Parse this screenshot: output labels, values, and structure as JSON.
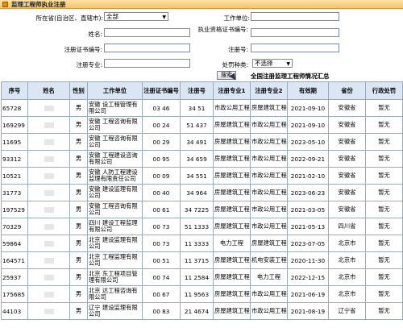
{
  "title": "监理工程师执业注册",
  "form": {
    "province_label": "所在省(自治区、直辖市):",
    "province_value": "全部",
    "unit_label": "工作单位:",
    "name_label": "姓名:",
    "license_label": "执业资格证书编号:",
    "reg_cert_label": "注册证书编号:",
    "reg_no_label": "注册号:",
    "major_label": "注册专业:",
    "penalty_label": "处罚种类:",
    "penalty_value": "不选择",
    "search_button": "搜索",
    "summary_link": "全国注册监理工程师情况汇总"
  },
  "table": {
    "headers": [
      "序号",
      "姓名",
      "性别",
      "工作单位",
      "注册证书编号",
      "注册号",
      "注册专业1",
      "注册专业2",
      "有效期",
      "省份",
      "行政处罚"
    ],
    "rows": [
      {
        "id": "65728",
        "gender": "男",
        "unit": "安徽 设工程管理有限公司",
        "cert": "03 46",
        "reg": "34 51",
        "major1": "市政公用工程",
        "major2": "房屋建筑工程",
        "valid": "2021-09-10",
        "prov": "安徽省",
        "penalty": "暂无"
      },
      {
        "id": "169299",
        "gender": "男",
        "unit": "安徽 工程咨询有限公司",
        "cert": "00 24",
        "reg": "51 437",
        "major1": "房屋建筑工程",
        "major2": "市政公用工程",
        "valid": "2021-09-10",
        "prov": "安徽省",
        "penalty": "暂无"
      },
      {
        "id": "11695",
        "gender": "男",
        "unit": "安徽 工程咨询有限公司",
        "cert": "00 29",
        "reg": "34 491",
        "major1": "房屋建筑工程",
        "major2": "市政公用工程",
        "valid": "2023-05-10",
        "prov": "安徽省",
        "penalty": "暂无"
      },
      {
        "id": "93312",
        "gender": "男",
        "unit": "安徽 工程建设咨询有限公司",
        "cert": "00 95",
        "reg": "34 659",
        "major1": "房屋建筑工程",
        "major2": "市政公用工程",
        "valid": "2022-09-21",
        "prov": "安徽省",
        "penalty": "暂无"
      },
      {
        "id": "10521",
        "gender": "男",
        "unit": "安徽 人防工程建设监理有限责任公司",
        "cert": "00 09",
        "reg": "34 551",
        "major1": "房屋建筑工程",
        "major2": "市政公用工程",
        "valid": "2021-02-10",
        "prov": "安徽省",
        "penalty": "暂无"
      },
      {
        "id": "31773",
        "gender": "男",
        "unit": "安徽 建设监理有限公司",
        "cert": "00 40",
        "reg": "34 964",
        "major1": "房屋建筑工程",
        "major2": "市政公用工程",
        "valid": "2023-06-23",
        "prov": "安徽省",
        "penalty": "暂无"
      },
      {
        "id": "197529",
        "gender": "男",
        "unit": "安徽 工程咨询有限公司",
        "cert": "00 61",
        "reg": "34 7225",
        "major1": "房屋建筑工程",
        "major2": "市政公用工程",
        "valid": "2021-03-05",
        "prov": "安徽省",
        "penalty": "暂无"
      },
      {
        "id": "70329",
        "gender": "男",
        "unit": "四川 建设工程监理有限公司",
        "cert": "00 73",
        "reg": "51 1333",
        "major1": "房屋建筑工程",
        "major2": "市政公用工程",
        "valid": "2021-05-13",
        "prov": "四川省",
        "penalty": "暂无"
      },
      {
        "id": "59864",
        "gender": "男",
        "unit": "北京 建设监理有限公司",
        "cert": "00 73",
        "reg": "11 3333",
        "major1": "电力工程",
        "major2": "房屋建筑工程",
        "valid": "2023-07-05",
        "prov": "北京市",
        "penalty": "暂无"
      },
      {
        "id": "164571",
        "gender": "男",
        "unit": "北京 工程监理有限公司",
        "cert": "00 51",
        "reg": "11 3715",
        "major1": "房屋建筑工程",
        "major2": "机电安装工程",
        "valid": "2020-11-30",
        "prov": "北京市",
        "penalty": "暂无"
      },
      {
        "id": "25937",
        "gender": "男",
        "unit": "北京 东工程项目管理有限公司",
        "cert": "00 74",
        "reg": "11 2584",
        "major1": "房屋建筑工程",
        "major2": "电力工程",
        "valid": "2022-12-15",
        "prov": "北京市",
        "penalty": "暂无"
      },
      {
        "id": "175685",
        "gender": "男",
        "unit": "北京 达工程咨询有限公司",
        "cert": "00 67",
        "reg": "11 9563",
        "major1": "房屋建筑工程",
        "major2": "市政公用工程",
        "valid": "2021-06-19",
        "prov": "北京市",
        "penalty": "暂无"
      },
      {
        "id": "44103",
        "gender": "男",
        "unit": "辽宁 建设监理有限公司",
        "cert": "00 83",
        "reg": "21 4674",
        "major1": "房屋建筑工程",
        "major2": "市政公用工程",
        "valid": "2021-08-19",
        "prov": "辽宁省",
        "penalty": "暂无"
      }
    ]
  }
}
